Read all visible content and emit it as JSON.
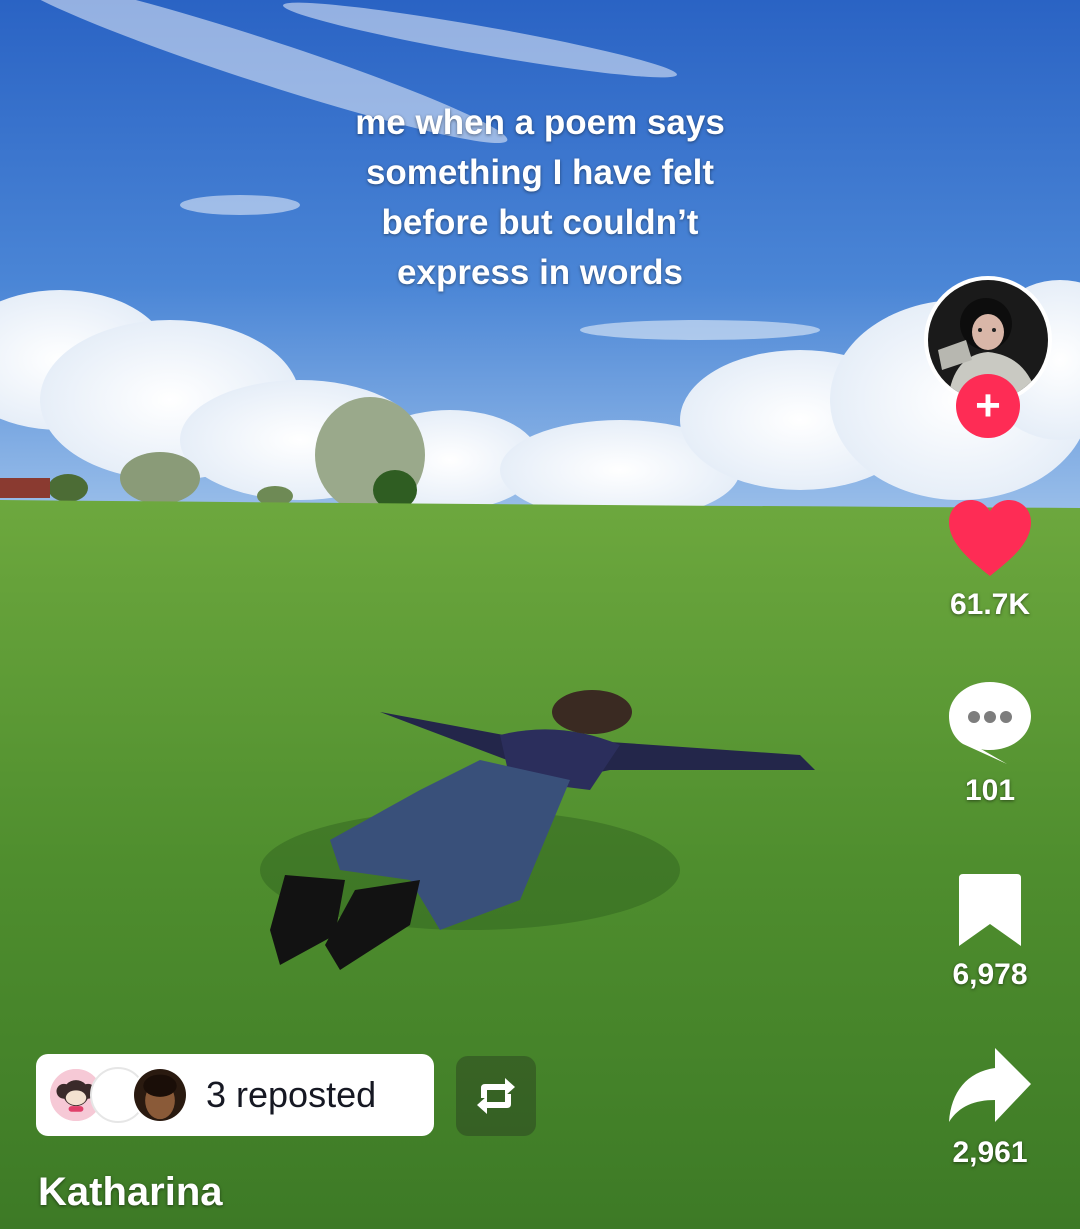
{
  "video": {
    "caption_lines": [
      "me when a poem says",
      "something I have felt",
      "before but couldn’t",
      "express in words"
    ]
  },
  "actions": {
    "likes": "61.7K",
    "comments": "101",
    "saves": "6,978",
    "shares": "2,961"
  },
  "repost": {
    "label": "3 reposted"
  },
  "author": {
    "name": "Katharina"
  },
  "colors": {
    "like_red": "#fe2c55",
    "follow_red": "#fe2c55",
    "text_white": "#ffffff"
  },
  "icons": [
    "plus-icon",
    "heart-icon",
    "comment-icon",
    "bookmark-icon",
    "share-icon",
    "repost-icon"
  ]
}
